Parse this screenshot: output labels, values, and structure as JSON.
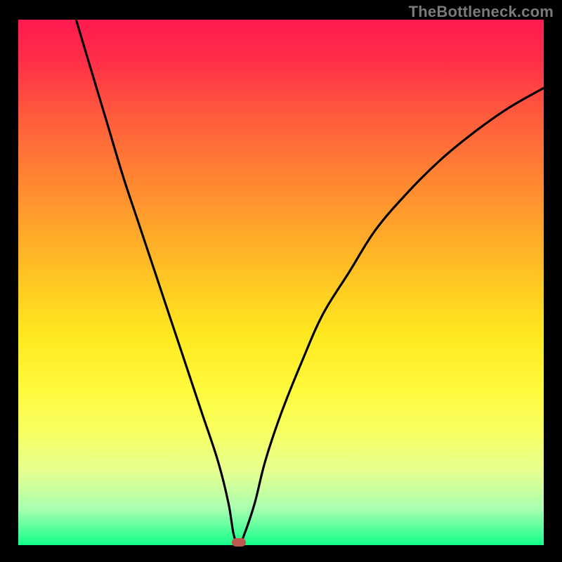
{
  "watermark": "TheBottleneck.com",
  "colors": {
    "frame": "#000000",
    "curve_stroke": "#000000",
    "marker": "#c0584f",
    "gradient_top": "#ff1a4f",
    "gradient_bottom": "#12ff8a",
    "watermark_text": "#7a7a7a"
  },
  "chart_data": {
    "type": "line",
    "title": "",
    "xlabel": "",
    "ylabel": "",
    "xlim": [
      0,
      100
    ],
    "ylim": [
      0,
      100
    ],
    "grid": false,
    "legend": false,
    "annotations": [
      {
        "type": "marker",
        "x": 42,
        "y": 0
      }
    ],
    "series": [
      {
        "name": "bottleneck-curve",
        "x": [
          11,
          14,
          17,
          20,
          23,
          26,
          29,
          32,
          35,
          38,
          40,
          41,
          42,
          43,
          45,
          47,
          50,
          54,
          58,
          63,
          68,
          74,
          80,
          86,
          93,
          100
        ],
        "values": [
          100,
          90,
          80,
          70,
          61,
          52,
          43,
          34,
          25,
          16,
          8,
          2,
          0,
          2,
          8,
          16,
          25,
          35,
          44,
          52,
          60,
          67,
          73,
          78,
          83,
          87
        ]
      }
    ]
  }
}
